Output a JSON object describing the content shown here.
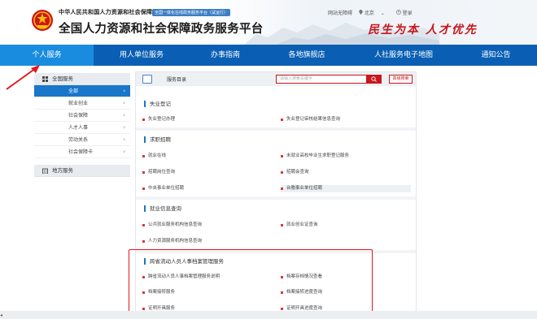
{
  "header": {
    "org_line": "中华人民共和国人力资源和社会保障部",
    "org_badge": "全国一体化在线政务服务平台（试运行）",
    "platform_title": "全国人力资源和社会保障政务服务平台",
    "top_links": {
      "accessibility": "网站无障碍",
      "location": "北京",
      "login": "登录"
    },
    "slogan": "民生为本 人才优先"
  },
  "nav": {
    "items": [
      "个人服务",
      "用人单位服务",
      "办事指南",
      "各地旗舰店",
      "人社服务电子地图",
      "通知公告"
    ],
    "active_index": 0
  },
  "sidebar": {
    "all_services": "全国服务",
    "items": [
      "全部",
      "就业创业",
      "社会保障",
      "人才人事",
      "劳动关系",
      "社会保障卡"
    ],
    "active_index": 0,
    "local_services": "地方服务"
  },
  "main": {
    "directory_label": "服务目录",
    "search_placeholder": "请输入搜索关键字",
    "advanced_search": "高级搜索",
    "sections": {
      "unemployment": {
        "title": "失业登记",
        "items": [
          "失业登记办理",
          "失业登记审核结果信息查询"
        ]
      },
      "job_search": {
        "title": "求职招聘",
        "items": [
          "就业在线",
          "未就业高校毕业生求职登记服务",
          "招聘岗位查询",
          "招聘会查询",
          "中央事业单位招聘",
          "台胞事业单位招聘"
        ]
      },
      "employment_info": {
        "title": "就业信息查询",
        "items": [
          "公共就业服务机构信息查询",
          "就业创业证查询",
          "人力资源服务机构信息查询"
        ]
      },
      "archives": {
        "title": "跨省流动人员人事档案管理服务",
        "items": [
          "跨省流动人员人事档案管理服务说明",
          "档案存档情况查看",
          "档案接转服务",
          "档案接转进度查询",
          "证明开具服务",
          "证明开具进度查询"
        ]
      }
    }
  },
  "colors": {
    "nav_blue": "#0a5fb4",
    "active_blue": "#1a8ce0",
    "accent_red": "#c8161d"
  }
}
